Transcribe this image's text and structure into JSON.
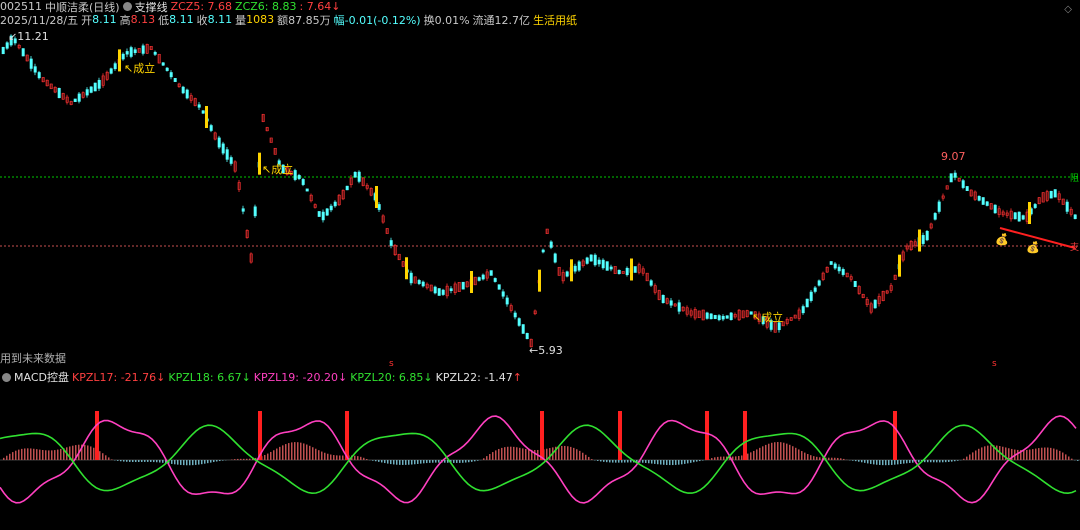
{
  "header": {
    "stock_code": "002511",
    "stock_name": "中顺洁柔",
    "period": "(日线)",
    "indicator_name": "支撑线",
    "zcz5_label": "ZCZ5: 7.68",
    "zcz6_label": "ZCZ6: 8.83",
    "zcz7_label": ": 7.64",
    "down_arrow": "↓"
  },
  "quote": {
    "date": "2025/11/28/五",
    "open_label": "开",
    "open": "8.11",
    "high_label": "高",
    "high": "8.13",
    "low_label": "低",
    "low": "8.11",
    "close_label": "收",
    "close": "8.11",
    "volume_label": "量",
    "volume": "1083",
    "amount": "额87.85万",
    "change": "幅-0.01(-0.12%)",
    "turnover": "换0.01%",
    "float_cap": "流通12.7亿",
    "sector": "生活用纸"
  },
  "main_chart": {
    "high_price": "11.21",
    "low_price": "5.93",
    "peak_price": "9.07",
    "future_note": "用到未来数据",
    "chengli_label": "成立",
    "right_tag_green": "阻",
    "right_tag_red": "支",
    "marker_s": "s"
  },
  "macd_panel": {
    "title": "MACD控盘",
    "kpzl17": "KPZL17: -21.76",
    "kpzl18": "KPZL18: 6.67",
    "kpzl19": "KPZL19: -20.20",
    "kpzl20": "KPZL20: 6.85",
    "kpzl22": "KPZL22: -1.47",
    "arrow_down": "↓",
    "arrow_up": "↑"
  },
  "colors": {
    "background": "#000000",
    "up_candle": "#ff3232",
    "down_candle": "#54ffff",
    "resistance_line": "#00c800",
    "support_line": "#c85050",
    "yellow": "#ffd400",
    "magenta": "#ff40c0",
    "green_line": "#30e030"
  }
}
